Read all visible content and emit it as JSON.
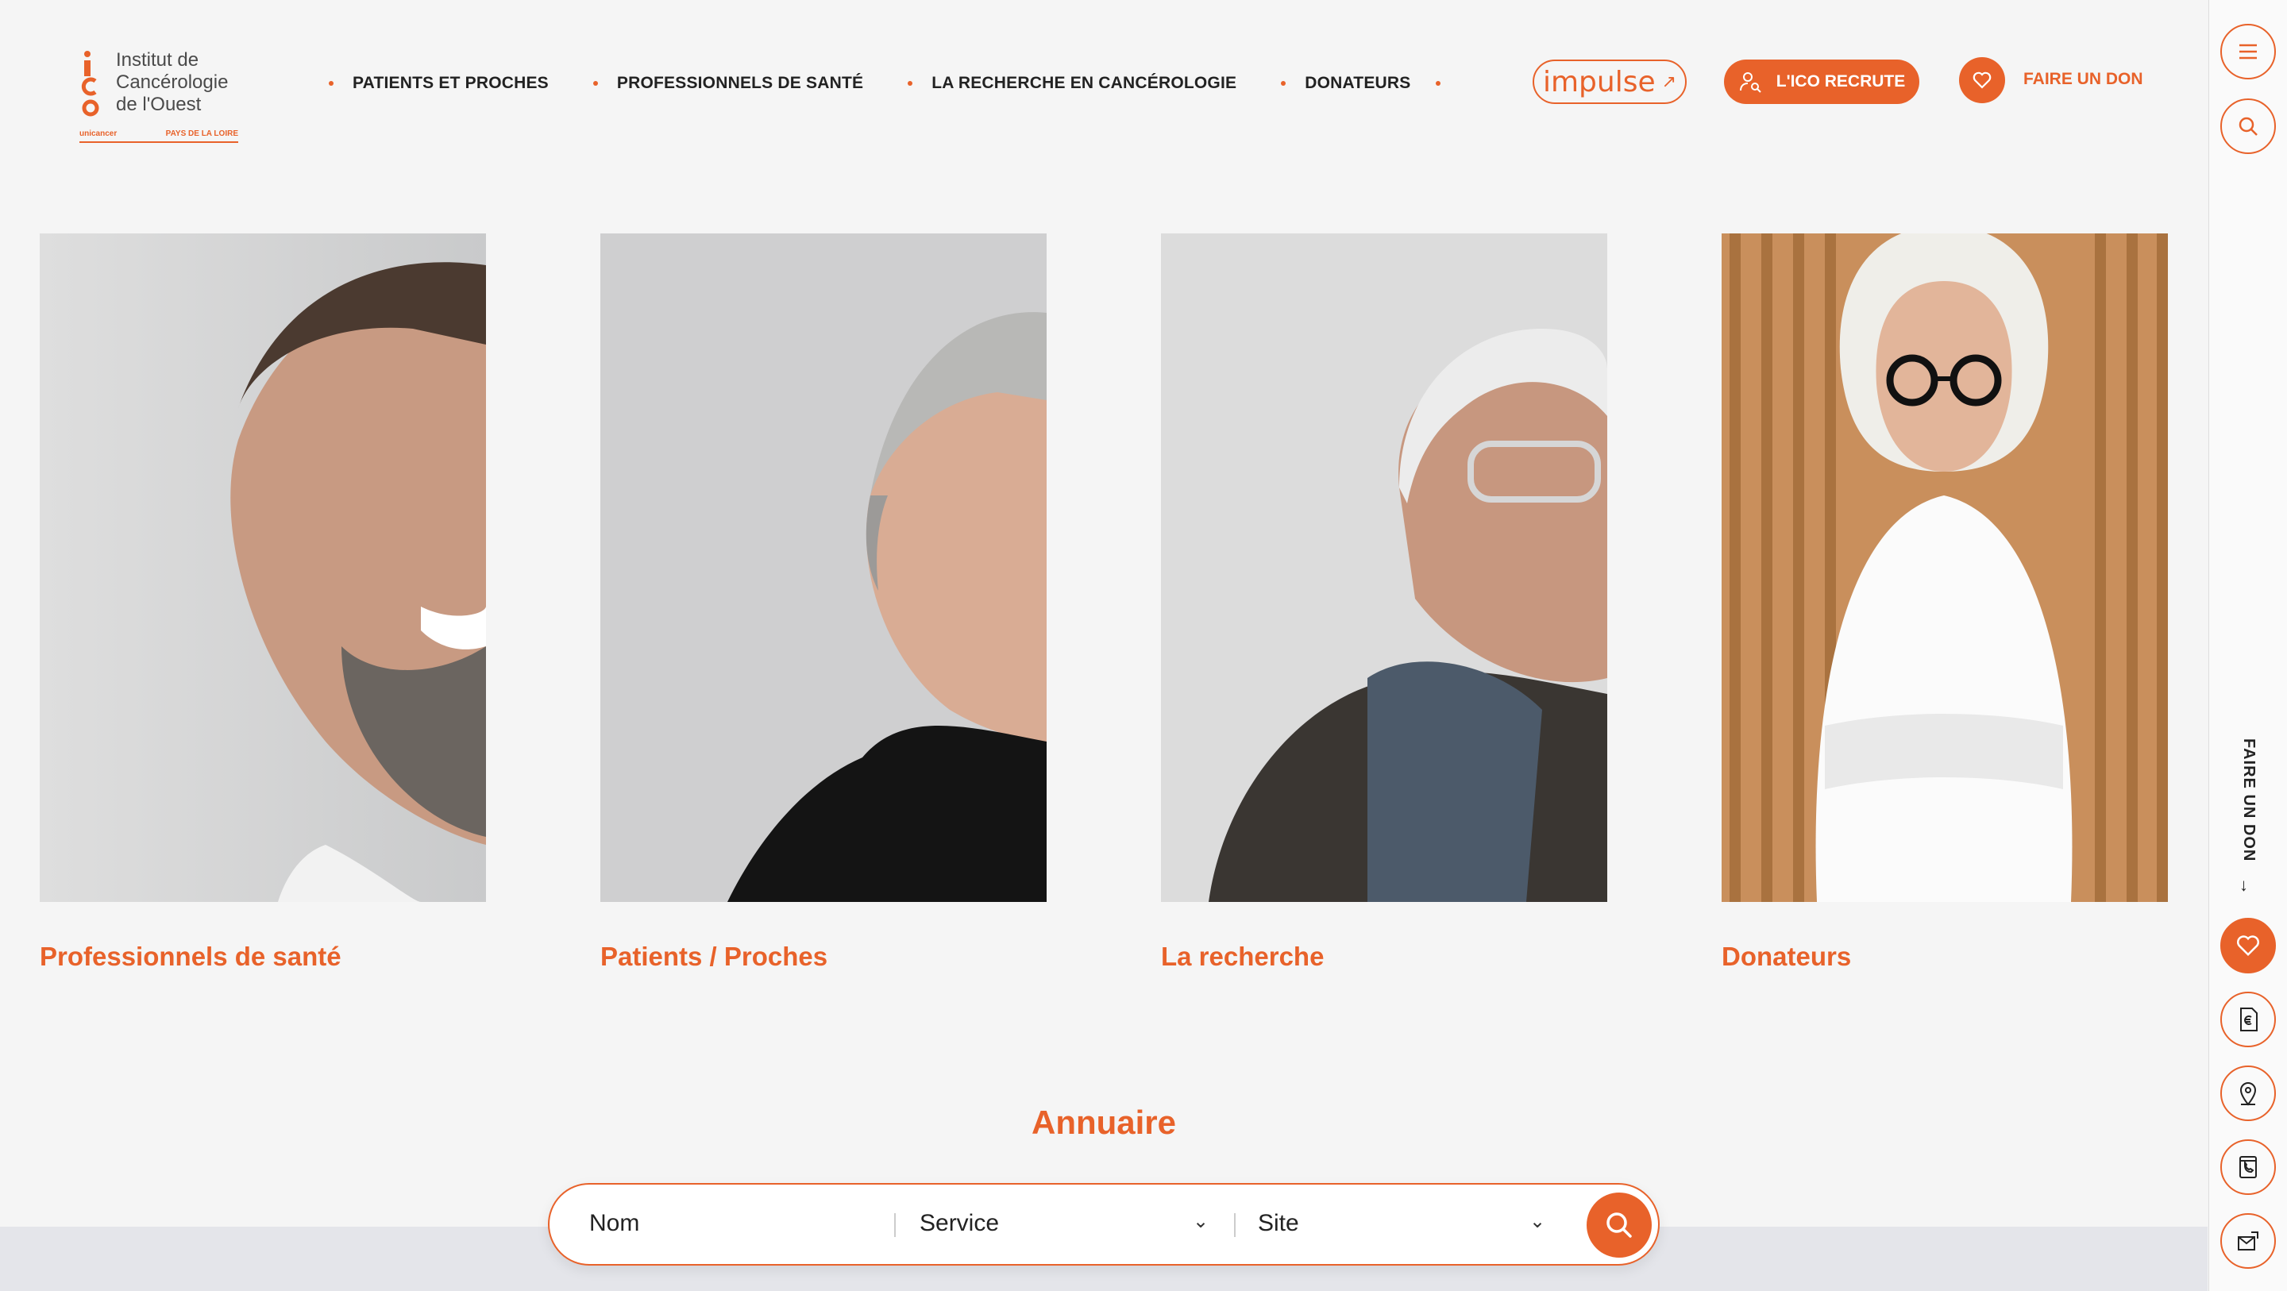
{
  "logo": {
    "line1": "Institut de",
    "line2": "Cancérologie",
    "line3": "de l'Ouest",
    "partner": "unicancer",
    "region": "PAYS DE LA LOIRE"
  },
  "nav": {
    "items": [
      {
        "label": "PATIENTS ET PROCHES"
      },
      {
        "label": "PROFESSIONNELS DE SANTÉ"
      },
      {
        "label": "LA RECHERCHE EN CANCÉROLOGIE"
      },
      {
        "label": "DONATEURS"
      }
    ]
  },
  "header": {
    "impulse_label": "impulse",
    "recrute_label": "L'ICO RECRUTE",
    "don_label": "FAIRE UN DON"
  },
  "rail": {
    "vertical_label": "FAIRE UN DON",
    "vertical_arrow": "↓",
    "icons": [
      "menu-icon",
      "search-icon",
      "heart-icon",
      "euro-document-icon",
      "location-pin-icon",
      "phone-book-icon",
      "mail-icon"
    ]
  },
  "cards": [
    {
      "title": "Professionnels de santé"
    },
    {
      "title": "Patients / Proches"
    },
    {
      "title": "La recherche"
    },
    {
      "title": "Donateurs"
    }
  ],
  "annuaire": {
    "title": "Annuaire",
    "name_field": "Nom",
    "service_field": "Service",
    "site_field": "Site"
  },
  "colors": {
    "accent": "#e8622a",
    "background": "#f5f5f5",
    "band": "#e4e5ea"
  }
}
